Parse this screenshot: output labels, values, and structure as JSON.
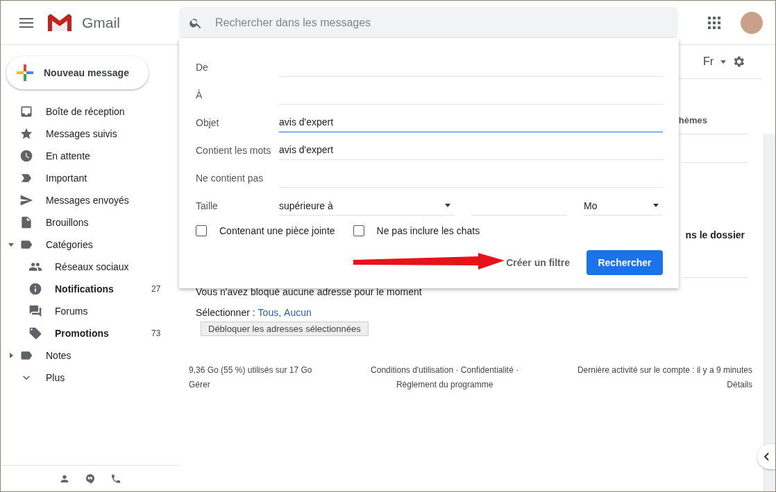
{
  "app": {
    "name": "Gmail"
  },
  "search": {
    "placeholder": "Rechercher dans les messages"
  },
  "compose": {
    "label": "Nouveau message"
  },
  "sidebar": {
    "items": [
      {
        "label": "Boîte de réception",
        "unread": false
      },
      {
        "label": "Messages suivis",
        "unread": false
      },
      {
        "label": "En attente",
        "unread": false
      },
      {
        "label": "Important",
        "unread": false
      },
      {
        "label": "Messages envoyés",
        "unread": false
      },
      {
        "label": "Brouillons",
        "unread": false
      },
      {
        "label": "Catégories",
        "unread": false,
        "expanded": true,
        "children": [
          {
            "label": "Réseaux sociaux",
            "unread": false
          },
          {
            "label": "Notifications",
            "unread": true,
            "count": "27"
          },
          {
            "label": "Forums",
            "unread": false
          },
          {
            "label": "Promotions",
            "unread": true,
            "count": "73"
          }
        ]
      },
      {
        "label": "Notes",
        "unread": false,
        "expanded": false
      },
      {
        "label": "Plus",
        "unread": false
      }
    ]
  },
  "settings_header": {
    "language": "Fr"
  },
  "background": {
    "tab_partial": "hèmes",
    "heading_partial": "ns le dossier",
    "empty_message": "Vous n'avez bloqué aucune adresse pour le moment",
    "select_label": "Sélectionner :",
    "select_links": [
      "Tous,",
      "Aucun"
    ],
    "unblock_button": "Débloquer les adresses sélectionnées"
  },
  "footer": {
    "storage": "9,36 Go (55 %) utilisés sur 17 Go",
    "manage": "Gérer",
    "terms": "Conditions d'utilisation · Confidentialité ·",
    "policy": "Règlement du programme",
    "activity": "Dernière activité sur le compte : il y a 9 minutes",
    "details": "Détails"
  },
  "filter_form": {
    "fields": [
      {
        "label": "De",
        "focused": false
      },
      {
        "label": "À",
        "focused": false
      },
      {
        "label": "Objet",
        "value": "avis d'expert",
        "focused": true
      },
      {
        "label": "Contient les mots",
        "value": "avis d'expert",
        "focused": false
      },
      {
        "label": "Ne contient pas",
        "focused": false
      }
    ],
    "size": {
      "label": "Taille",
      "comparator": "supérieure à",
      "unit": "Mo"
    },
    "checkboxes": [
      {
        "label": "Contenant une pièce jointe",
        "checked": false
      },
      {
        "label": "Ne pas inclure les chats",
        "checked": false
      }
    ],
    "create_filter": "Créer un filtre",
    "search_button": "Rechercher"
  }
}
